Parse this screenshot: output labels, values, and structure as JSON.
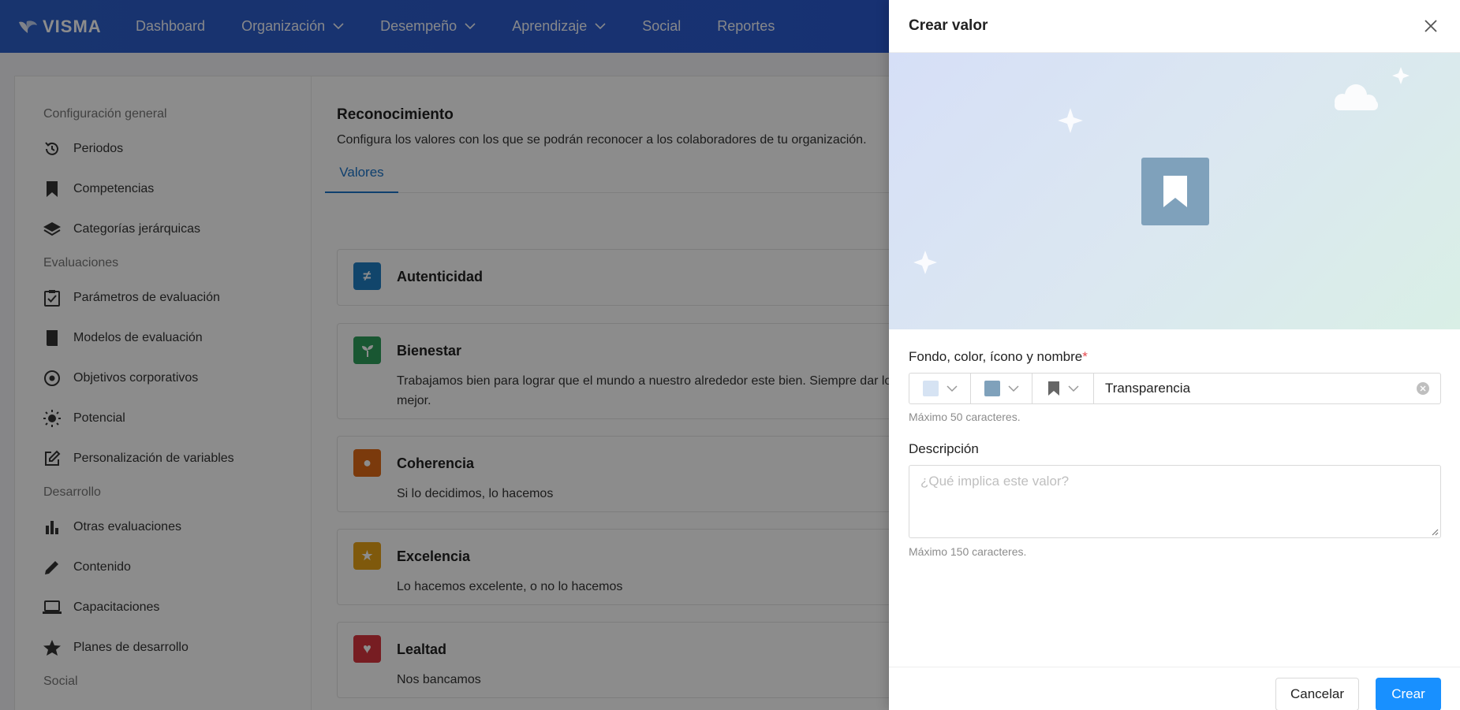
{
  "brand": "VISMA",
  "nav": {
    "items": [
      {
        "label": "Dashboard"
      },
      {
        "label": "Organización"
      },
      {
        "label": "Desempeño"
      },
      {
        "label": "Aprendizaje"
      },
      {
        "label": "Social"
      },
      {
        "label": "Reportes"
      }
    ]
  },
  "sidebar": {
    "section_general": "Configuración general",
    "section_eval": "Evaluaciones",
    "section_dev": "Desarrollo",
    "section_social": "Social",
    "items": [
      {
        "label": "Periodos"
      },
      {
        "label": "Competencias"
      },
      {
        "label": "Categorías jerárquicas"
      },
      {
        "label": "Parámetros de evaluación"
      },
      {
        "label": "Modelos de evaluación"
      },
      {
        "label": "Objetivos corporativos"
      },
      {
        "label": "Potencial"
      },
      {
        "label": "Personalización de variables"
      },
      {
        "label": "Otras evaluaciones"
      },
      {
        "label": "Contenido"
      },
      {
        "label": "Capacitaciones"
      },
      {
        "label": "Planes de desarrollo"
      }
    ]
  },
  "content": {
    "title": "Reconocimiento",
    "subtitle": "Configura los valores con los que se podrán reconocer a los colaboradores de tu organización.",
    "tab": "Valores",
    "values": [
      {
        "name": "Autenticidad",
        "desc": "",
        "color": "#1f7fc4",
        "glyph": "≠"
      },
      {
        "name": "Bienestar",
        "desc": "Trabajamos bien para lograr que el mundo a nuestro alrededor este bien. Siempre dar lo mejor.",
        "color": "#2e9e5b",
        "glyph": "sprout"
      },
      {
        "name": "Coherencia",
        "desc": "Si lo decidimos, lo hacemos",
        "color": "#e06a16",
        "glyph": "●"
      },
      {
        "name": "Excelencia",
        "desc": "Lo hacemos excelente, o no lo hacemos",
        "color": "#e8a317",
        "glyph": "★"
      },
      {
        "name": "Lealtad",
        "desc": "Nos bancamos",
        "color": "#d9363e",
        "glyph": "♥"
      }
    ]
  },
  "drawer": {
    "title": "Crear valor",
    "field_label": "Fondo, color, ícono y nombre",
    "required_mark": "*",
    "name_value": "Transparencia",
    "name_hint": "Máximo 50 caracteres.",
    "desc_label": "Descripción",
    "desc_placeholder": "¿Qué implica este valor?",
    "desc_hint": "Máximo 150 caracteres.",
    "cancel_label": "Cancelar",
    "create_label": "Crear",
    "background_swatch": "#d6e3f3",
    "color_swatch": "#7fa1bb",
    "icon": "bookmark-icon"
  }
}
